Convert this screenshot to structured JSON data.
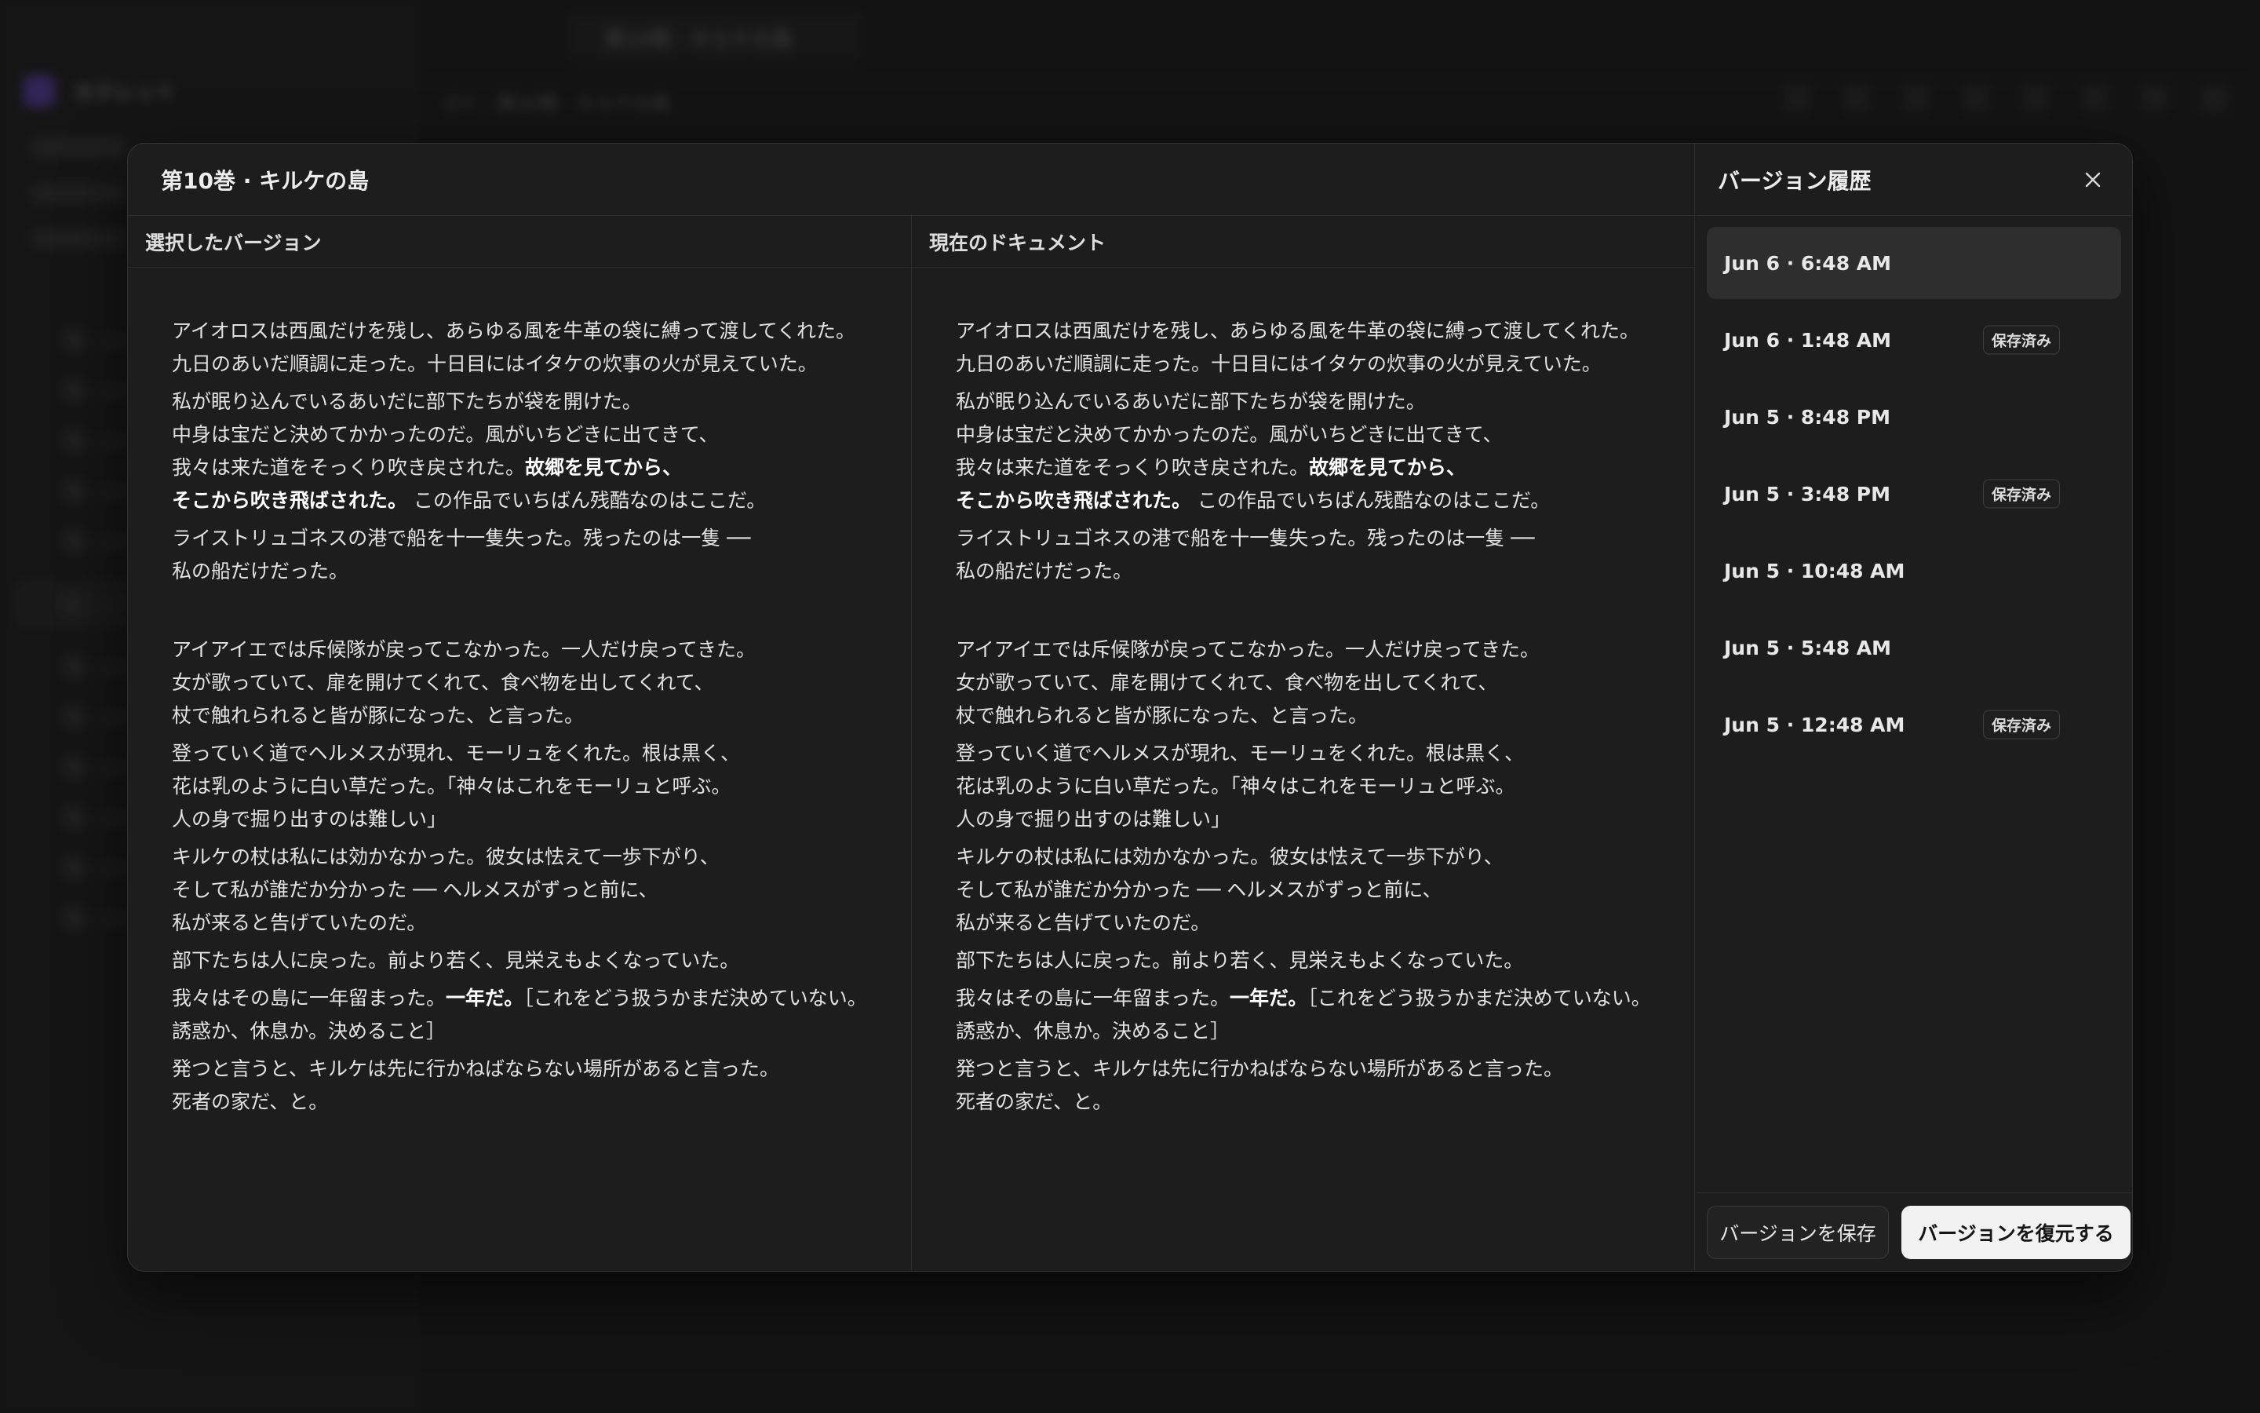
{
  "background": {
    "tab_title": "第10巻 · キルケの島",
    "breadcrumb": "ゴミ  ›  第10巻 · キルケの島",
    "workspace_name": "ホテレット"
  },
  "dialog": {
    "doc_title": "第10巻 · キルケの島",
    "left_header": "選択したバージョン",
    "right_header": "現在のドキュメント"
  },
  "text": {
    "p1": {
      "l1": "アイオロスは西風だけを残し、あらゆる風を牛革の袋に縛って渡してくれた。",
      "l2": "九日のあいだ順調に走った。十日目にはイタケの炊事の火が見えていた。"
    },
    "p2": {
      "l1": "私が眠り込んでいるあいだに部下たちが袋を開けた。",
      "l2": "中身は宝だと決めてかかったのだ。風がいちどきに出てきて、",
      "l3a": "我々は来た道をそっくり吹き戻された。",
      "l3b": "故郷を見てから、",
      "l4a": "そこから吹き飛ばされた。",
      "l4b": " この作品でいちばん残酷なのはここだ。"
    },
    "p3": {
      "l1": "ライストリュゴネスの港で船を十一隻失った。残ったのは一隻 ──",
      "l2": "私の船だけだった。"
    },
    "p4": {
      "l1": "アイアイエでは斥候隊が戻ってこなかった。一人だけ戻ってきた。",
      "l2": "女が歌っていて、扉を開けてくれて、食べ物を出してくれて、",
      "l3": "杖で触れられると皆が豚になった、と言った。"
    },
    "p5": {
      "l1": "登っていく道でヘルメスが現れ、モーリュをくれた。根は黒く、",
      "l2": "花は乳のように白い草だった。「神々はこれをモーリュと呼ぶ。",
      "l3": "人の身で掘り出すのは難しい」"
    },
    "p6": {
      "l1": "キルケの杖は私には効かなかった。彼女は怯えて一歩下がり、",
      "l2": "そして私が誰だか分かった ── ヘルメスがずっと前に、",
      "l3": "私が来ると告げていたのだ。"
    },
    "p7": {
      "l1": "部下たちは人に戻った。前より若く、見栄えもよくなっていた。"
    },
    "p8": {
      "l1a": "我々はその島に一年留まった。",
      "l1b": "一年だ。",
      "l1c": "［これをどう扱うかまだ決めていない。",
      "l2": "誘惑か、休息か。決めること］"
    },
    "p9": {
      "l1": "発つと言うと、キルケは先に行かねばならない場所があると言った。",
      "l2": "死者の家だ、と。"
    }
  },
  "versions": {
    "title": "バージョン履歴",
    "items": [
      {
        "time": "Jun 6 · 6:48 AM",
        "badge": ""
      },
      {
        "time": "Jun 6 · 1:48 AM",
        "badge": "保存済み"
      },
      {
        "time": "Jun 5 · 8:48 PM",
        "badge": ""
      },
      {
        "time": "Jun 5 · 3:48 PM",
        "badge": "保存済み"
      },
      {
        "time": "Jun 5 · 10:48 AM",
        "badge": ""
      },
      {
        "time": "Jun 5 · 5:48 AM",
        "badge": ""
      },
      {
        "time": "Jun 5 · 12:48 AM",
        "badge": "保存済み"
      }
    ],
    "save_label": "バージョンを保存",
    "restore_label": "バージョンを復元する"
  }
}
